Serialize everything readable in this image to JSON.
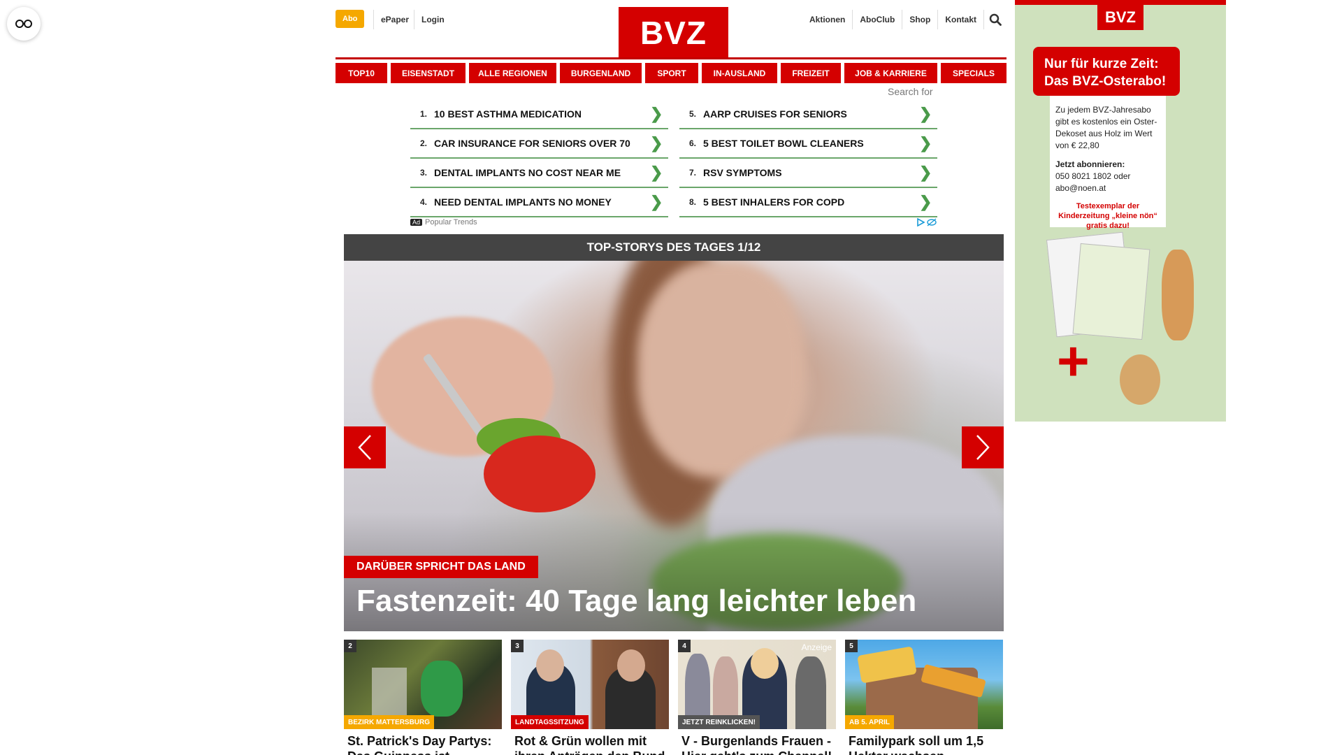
{
  "header": {
    "abo_label": "Abo",
    "epaper_label": "ePaper",
    "login_label": "Login",
    "logo_text": "BVZ",
    "right_links": [
      "Aktionen",
      "AboClub",
      "Shop",
      "Kontakt"
    ]
  },
  "nav": {
    "items": [
      "TOP10",
      "EISENSTADT",
      "ALLE REGIONEN",
      "BURGENLAND",
      "SPORT",
      "IN-AUSLAND",
      "FREIZEIT",
      "JOB & KARRIERE",
      "SPECIALS"
    ]
  },
  "search_for": "Search for",
  "ad_list": {
    "left": [
      {
        "num": "1.",
        "label": "10 BEST ASTHMA MEDICATION"
      },
      {
        "num": "2.",
        "label": "CAR INSURANCE FOR SENIORS OVER 70"
      },
      {
        "num": "3.",
        "label": "DENTAL IMPLANTS NO COST NEAR ME"
      },
      {
        "num": "4.",
        "label": "NEED DENTAL IMPLANTS NO MONEY"
      }
    ],
    "right": [
      {
        "num": "5.",
        "label": "AARP CRUISES FOR SENIORS"
      },
      {
        "num": "6.",
        "label": "5 BEST TOILET BOWL CLEANERS"
      },
      {
        "num": "7.",
        "label": "RSV SYMPTOMS"
      },
      {
        "num": "8.",
        "label": "5 BEST INHALERS FOR COPD"
      }
    ],
    "chevron": "❯",
    "ad_badge": "Ad",
    "footer": "Popular Trends"
  },
  "top_stories": {
    "bar_title": "TOP-STORYS DES TAGES 1/12",
    "kicker": "DARÜBER SPRICHT DAS LAND",
    "headline": "Fastenzeit: 40 Tage lang leichter leben"
  },
  "teasers": [
    {
      "num": "2",
      "tag": "BEZIRK MATTERSBURG",
      "tag_color": "#f5a800",
      "title_line1": "St. Patrick's Day Partys:",
      "title_line2": "Das Guinness ist"
    },
    {
      "num": "3",
      "tag": "LANDTAGSSITZUNG",
      "tag_color": "#d40000",
      "title_line1": "Rot & Grün wollen mit",
      "title_line2": "ihren Anträgen den Bund"
    },
    {
      "num": "4",
      "tag": "JETZT REINKLICKEN!",
      "tag_color": "#555555",
      "anzeige": "Anzeige",
      "title_line1": "V - Burgenlands Frauen -",
      "title_line2": "Hier geht's zum Channel!"
    },
    {
      "num": "5",
      "tag": "AB 5. APRIL",
      "tag_color": "#f5a800",
      "title_line1": "Familypark soll um 1,5",
      "title_line2": "Hektar wachsen"
    }
  ],
  "side_ad": {
    "logo": "BVZ",
    "headline_line1": "Nur für kurze Zeit:",
    "headline_line2": "Das BVZ-Osterabo!",
    "body": "Zu jedem BVZ-Jahresabo gibt es kostenlos ein Oster-Dekoset aus Holz im Wert von € 22,80",
    "cta": "Jetzt abonnieren:",
    "contact": "050 8021 1802 oder abo@noen.at",
    "note": "Testexemplar der Kinderzeitung „kleine nön“ gratis dazu!",
    "plus": "+"
  },
  "colors": {
    "brand_red": "#d40000",
    "abo_orange": "#f5a800",
    "ad_green": "#4a9a4a",
    "dark_bar": "#444444"
  },
  "icons": [
    "accessibility-glasses-icon",
    "search-icon",
    "arrow-left-icon",
    "arrow-right-icon",
    "chevron-right-icon",
    "adchoices-icon"
  ]
}
